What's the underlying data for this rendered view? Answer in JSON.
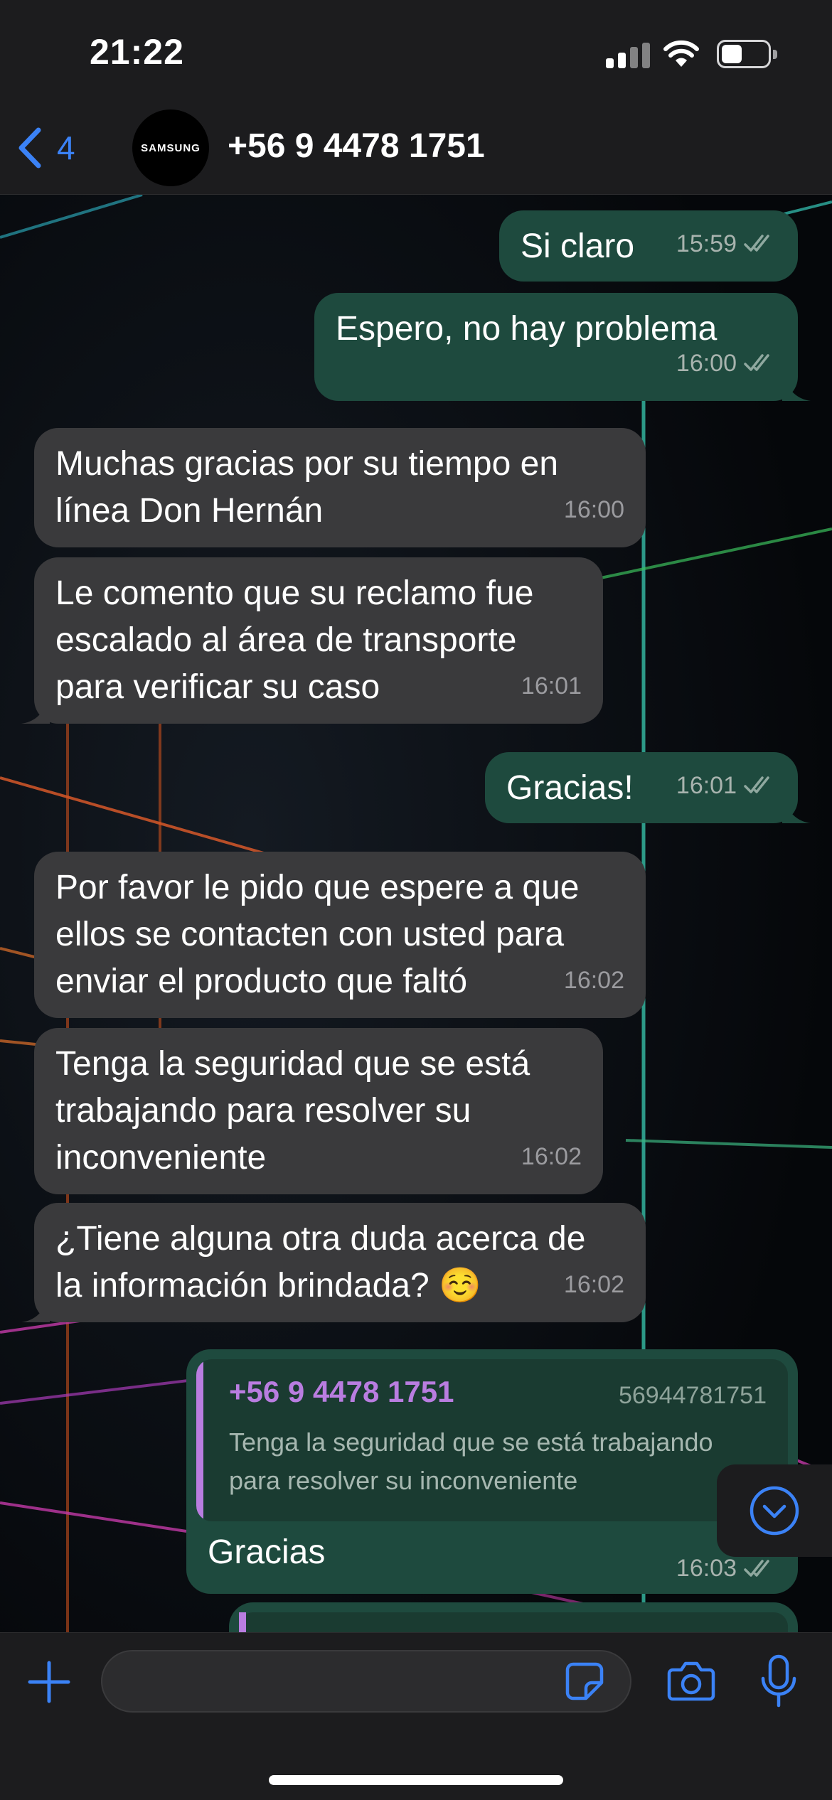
{
  "status": {
    "time": "21:22"
  },
  "header": {
    "back_count": "4",
    "avatar_text": "SAMSUNG",
    "contact_name": "+56 9 4478 1751"
  },
  "messages": [
    {
      "dir": "out",
      "lines": [
        "Si claro"
      ],
      "time": "15:59"
    },
    {
      "dir": "out",
      "lines": [
        "Espero, no hay problema"
      ],
      "time": "16:00"
    },
    {
      "dir": "in",
      "lines": [
        "Muchas gracias por su tiempo en",
        "línea Don Hernán"
      ],
      "time": "16:00"
    },
    {
      "dir": "in",
      "lines": [
        "Le comento que su reclamo fue",
        "escalado al área de transporte",
        "para verificar su caso"
      ],
      "time": "16:01"
    },
    {
      "dir": "out",
      "lines": [
        "Gracias!"
      ],
      "time": "16:01"
    },
    {
      "dir": "in",
      "lines": [
        "Por favor le pido que espere a que",
        "ellos se contacten con usted para",
        "enviar el producto que faltó"
      ],
      "time": "16:02"
    },
    {
      "dir": "in",
      "lines": [
        "Tenga la seguridad que se está",
        "trabajando para resolver su",
        "inconveniente"
      ],
      "time": "16:02"
    },
    {
      "dir": "in",
      "lines": [
        "¿Tiene alguna otra duda acerca de",
        "la información brindada? ☺️"
      ],
      "time": "16:02"
    }
  ],
  "reply": {
    "quoted_name": "+56 9 4478 1751",
    "quoted_number": "56944781751",
    "quoted_text_1": "Tenga la seguridad que se está trabajando",
    "quoted_text_2": "para resolver su inconveniente",
    "text": "Gracias",
    "time": "16:03"
  },
  "composer": {
    "placeholder": ""
  },
  "colors": {
    "accent": "#3b82f6",
    "outgoing_bubble": "#1e4a3e",
    "incoming_bubble": "#3a3a3c",
    "quote_name": "#b97de0"
  }
}
